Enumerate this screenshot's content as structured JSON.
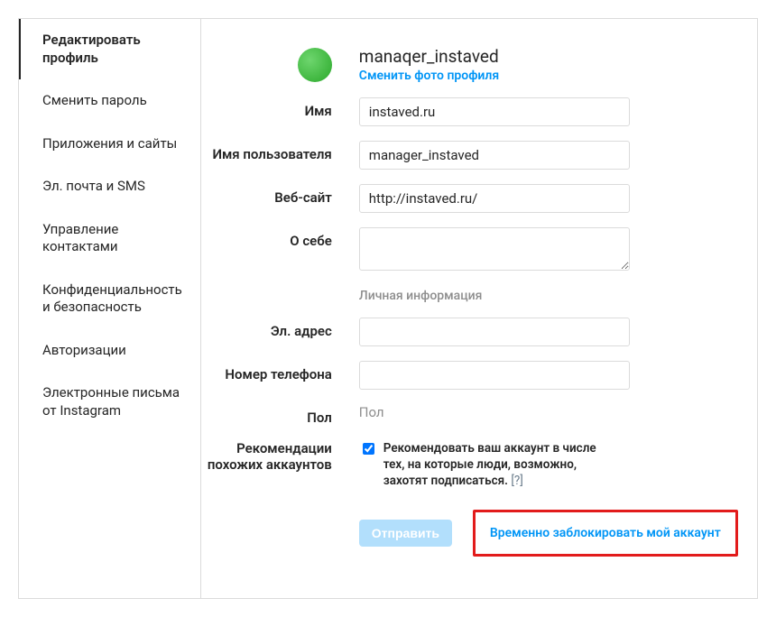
{
  "sidebar": {
    "items": [
      {
        "label": "Редактировать профиль",
        "active": true
      },
      {
        "label": "Сменить пароль"
      },
      {
        "label": "Приложения и сайты"
      },
      {
        "label": "Эл. почта и SMS"
      },
      {
        "label": "Управление контактами"
      },
      {
        "label": "Конфиденциальность и безопасность"
      },
      {
        "label": "Авторизации"
      },
      {
        "label": "Электронные письма от Instagram"
      }
    ]
  },
  "profile": {
    "username_display": "manaqer_instaved",
    "change_photo": "Сменить фото профиля",
    "labels": {
      "name": "Имя",
      "username": "Имя пользователя",
      "website": "Веб-сайт",
      "bio": "О себе",
      "private_section": "Личная информация",
      "email": "Эл. адрес",
      "phone": "Номер телефона",
      "gender": "Пол",
      "recommendations": "Рекомендации похожих аккаунтов"
    },
    "values": {
      "name": "instaved.ru",
      "username": "manager_instaved",
      "website": "http://instaved.ru/",
      "bio": "",
      "email": "",
      "phone": "",
      "gender_placeholder": "Пол"
    },
    "recommendation_text": "Рекомендовать ваш аккаунт в числе тех, на которые люди, возможно, захотят подписаться.",
    "recommendation_help": "[?]",
    "submit": "Отправить",
    "disable_account": "Временно заблокировать мой аккаунт"
  }
}
